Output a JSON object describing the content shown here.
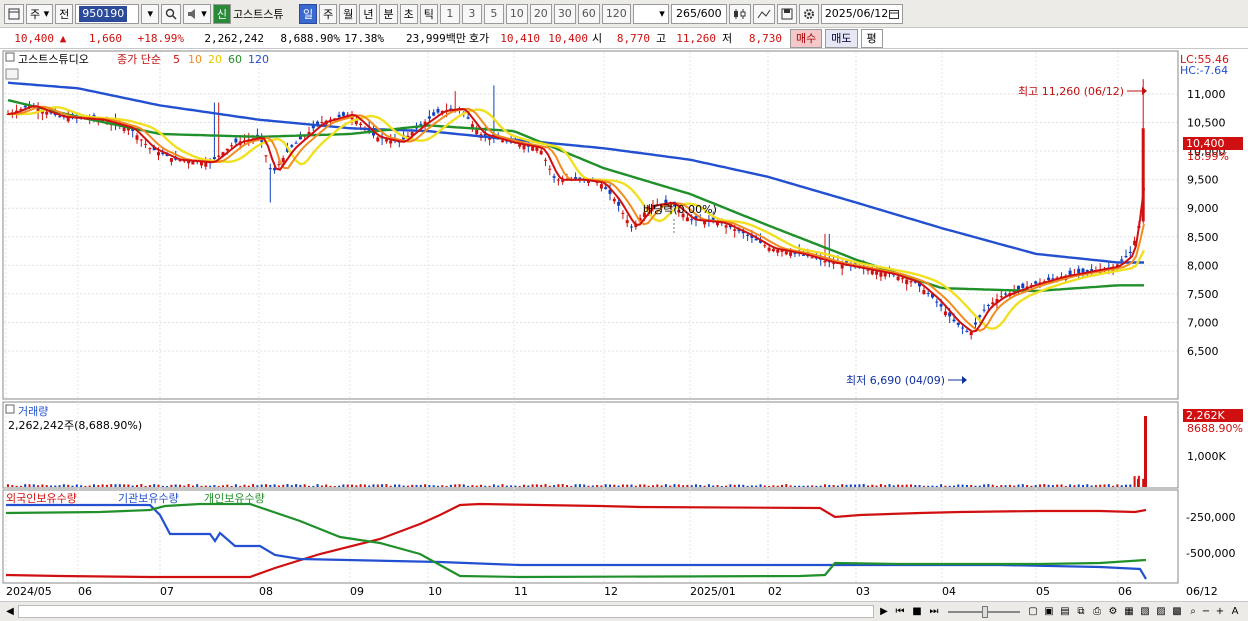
{
  "toolbar": {
    "period": "주",
    "prev_label": "전",
    "stock_code": "950190",
    "new_badge": "신",
    "stock_name": "고스트스튜",
    "periods": [
      "일",
      "주",
      "월",
      "년",
      "분",
      "초",
      "틱"
    ],
    "intervals": [
      "1",
      "3",
      "5",
      "10",
      "20",
      "30",
      "60",
      "120"
    ],
    "count": "265",
    "count_max": "/600",
    "date": "2025/06/12"
  },
  "quote": {
    "price": "10,400",
    "change_arrow": "▲",
    "change": "1,660",
    "change_pct": "+18.99%",
    "volume": "2,262,242",
    "volume_pct": "8,688.90%",
    "turnover": "17.38%",
    "amount": "23,999백만",
    "hoga_label": "호가",
    "ask": "10,410",
    "bid": "10,400",
    "open_label": "시",
    "open": "8,770",
    "high_label": "고",
    "high": "11,260",
    "low_label": "저",
    "low": "8,730",
    "buy": "매수",
    "sell": "매도",
    "eval": "평"
  },
  "legend": {
    "name": "고스트스튜디오",
    "ma_label": "종가 단순",
    "ma": [
      {
        "period": "5",
        "color": "#d01010"
      },
      {
        "period": "10",
        "color": "#f28c1e"
      },
      {
        "period": "20",
        "color": "#f0e020"
      },
      {
        "period": "60",
        "color": "#20902a"
      },
      {
        "period": "120",
        "color": "#2250d0"
      }
    ]
  },
  "price_panel": {
    "lc": "LC:55.46",
    "hc": "HC:-7.64",
    "current_box": "10,400",
    "current_pct": "18.99%",
    "high_note": "최고 11,260 (06/12)",
    "low_note": "최저 6,690 (04/09)",
    "dividend_note": "배당락(0.00%)",
    "y_ticks": [
      "11,000",
      "10,500",
      "10,000",
      "9,500",
      "9,000",
      "8,500",
      "8,000",
      "7,500",
      "7,000",
      "6,500"
    ]
  },
  "volume_panel": {
    "title": "거래량",
    "value": "2,262,242주(8,688.90%)",
    "current_box": "2,262K",
    "current_pct": "8688.90%",
    "y_tick": "1,000K"
  },
  "holder_panel": {
    "labels": [
      {
        "text": "외국인보유수량",
        "color": "#d01010"
      },
      {
        "text": "기관보유수량",
        "color": "#2250d0"
      },
      {
        "text": "개인보유수량",
        "color": "#20902a"
      }
    ],
    "y_ticks": [
      "-250,000",
      "-500,000"
    ]
  },
  "x_axis": [
    "2024/05",
    "06",
    "07",
    "08",
    "09",
    "10",
    "11",
    "12",
    "2025/01",
    "02",
    "03",
    "04",
    "05",
    "06",
    "06/12"
  ],
  "chart_data": {
    "type": "line",
    "title": "고스트스튜디오",
    "x": [
      "2024/05",
      "06",
      "07",
      "08",
      "09",
      "10",
      "11",
      "12",
      "2025/01",
      "02",
      "03",
      "04",
      "05",
      "06"
    ],
    "series": [
      {
        "name": "120",
        "values": [
          11200,
          11100,
          10800,
          10550,
          10400,
          10350,
          10200,
          10050,
          9850,
          9550,
          9100,
          8650,
          8200,
          8050
        ]
      },
      {
        "name": "60",
        "values": [
          10900,
          10600,
          10300,
          10250,
          10300,
          10450,
          10350,
          9700,
          9250,
          8700,
          8100,
          7600,
          7550,
          7650
        ]
      }
    ],
    "high": 11260,
    "low": 6690,
    "ylim": [
      6500,
      11400
    ]
  }
}
